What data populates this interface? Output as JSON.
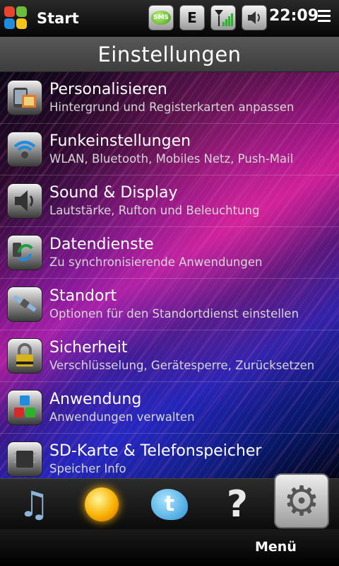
{
  "statusbar": {
    "start_label": "Start",
    "icons": [
      {
        "name": "sms-icon",
        "label": "SMS"
      },
      {
        "name": "edge-network-icon",
        "label": "E"
      },
      {
        "name": "signal-strength-icon"
      },
      {
        "name": "volume-icon"
      }
    ],
    "clock": "22:09"
  },
  "title": "Einstellungen",
  "items": [
    {
      "icon": "personalize-icon",
      "title": "Personalisieren",
      "subtitle": "Hintergrund und Registerkarten anpassen"
    },
    {
      "icon": "wireless-icon",
      "title": "Funkeinstellungen",
      "subtitle": "WLAN, Bluetooth, Mobiles Netz, Push-Mail"
    },
    {
      "icon": "speaker-icon",
      "title": "Sound & Display",
      "subtitle": "Lautstärke, Rufton und Beleuchtung"
    },
    {
      "icon": "sync-icon",
      "title": "Datendienste",
      "subtitle": "Zu synchronisierende Anwendungen"
    },
    {
      "icon": "location-icon",
      "title": "Standort",
      "subtitle": "Optionen für den Standortdienst einstellen"
    },
    {
      "icon": "lock-icon",
      "title": "Sicherheit",
      "subtitle": "Verschlüsselung, Gerätesperre, Zurücksetzen"
    },
    {
      "icon": "apps-cubes-icon",
      "title": "Anwendung",
      "subtitle": "Anwendungen verwalten"
    },
    {
      "icon": "memory-card-icon",
      "title": "SD-Karte & Telefonspeicher",
      "subtitle": "Speicher Info"
    }
  ],
  "tabs": [
    {
      "name": "music-tab-icon"
    },
    {
      "name": "weather-tab-icon"
    },
    {
      "name": "twitter-tab-icon"
    },
    {
      "name": "help-tab-icon"
    },
    {
      "name": "settings-tab-icon",
      "active": true
    }
  ],
  "softkeys": {
    "right": "Menü"
  }
}
